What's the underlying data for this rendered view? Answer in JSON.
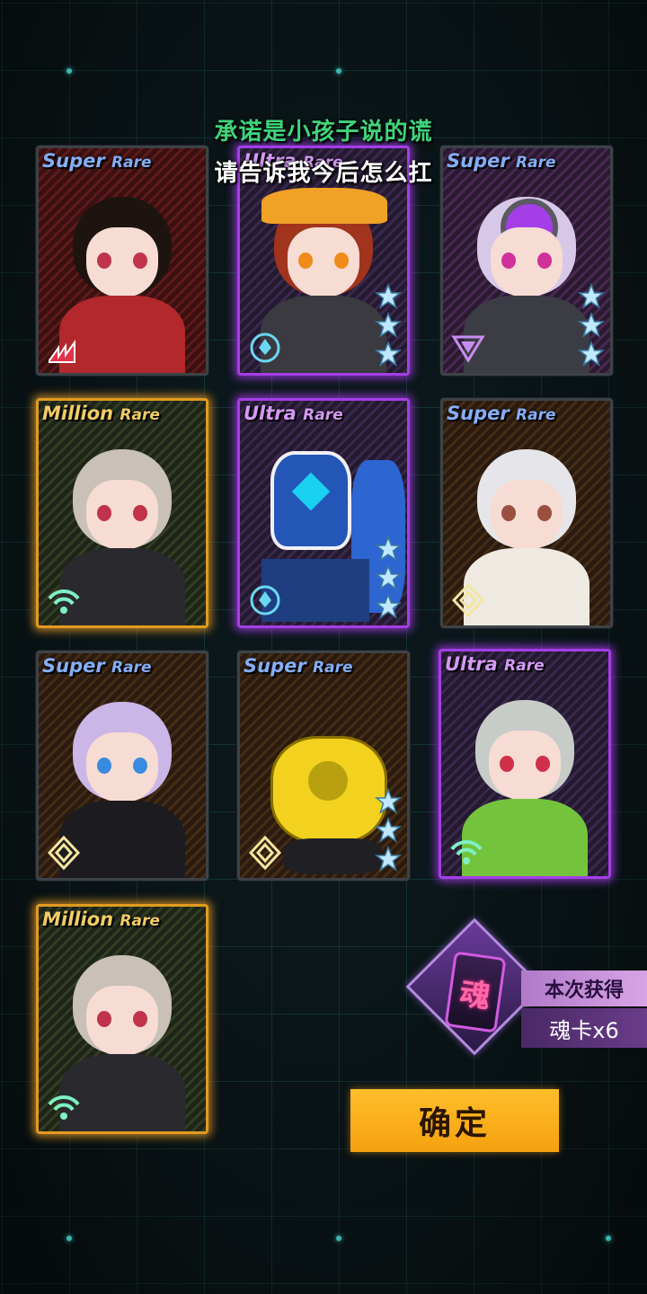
{
  "subtitles": {
    "line1": "承诺是小孩子说的谎",
    "line2": "请告诉我今后怎么扛"
  },
  "cards": [
    {
      "rarity": "Super",
      "rarity_suffix": "Rare",
      "stars": 0,
      "class_icon": "claw-class-icon"
    },
    {
      "rarity": "Ultra",
      "rarity_suffix": "Rare",
      "stars": 3,
      "class_icon": "ring-class-icon"
    },
    {
      "rarity": "Super",
      "rarity_suffix": "Rare",
      "stars": 3,
      "class_icon": "triangle-class-icon"
    },
    {
      "rarity": "Million",
      "rarity_suffix": "Rare",
      "stars": 0,
      "class_icon": "signal-class-icon"
    },
    {
      "rarity": "Ultra",
      "rarity_suffix": "Rare",
      "stars": 3,
      "class_icon": "ring-class-icon"
    },
    {
      "rarity": "Super",
      "rarity_suffix": "Rare",
      "stars": 0,
      "class_icon": "diamond-class-icon"
    },
    {
      "rarity": "Super",
      "rarity_suffix": "Rare",
      "stars": 0,
      "class_icon": "diamond-class-icon"
    },
    {
      "rarity": "Super",
      "rarity_suffix": "Rare",
      "stars": 3,
      "class_icon": "diamond-class-icon"
    },
    {
      "rarity": "Ultra",
      "rarity_suffix": "Rare",
      "stars": 0,
      "class_icon": "signal-class-icon"
    },
    {
      "rarity": "Million",
      "rarity_suffix": "Rare",
      "stars": 0,
      "class_icon": "signal-class-icon"
    }
  ],
  "reward": {
    "card_glyph": "魂",
    "label": "本次获得",
    "amount": "魂卡x6"
  },
  "confirm_label": "确定",
  "colors": {
    "super_rare": "#86aef5",
    "ultra_rare": "#d39af5",
    "million_rare": "#f1cc67",
    "confirm_button": "#f5a10f",
    "subtitle_green": "#3fd47a"
  }
}
